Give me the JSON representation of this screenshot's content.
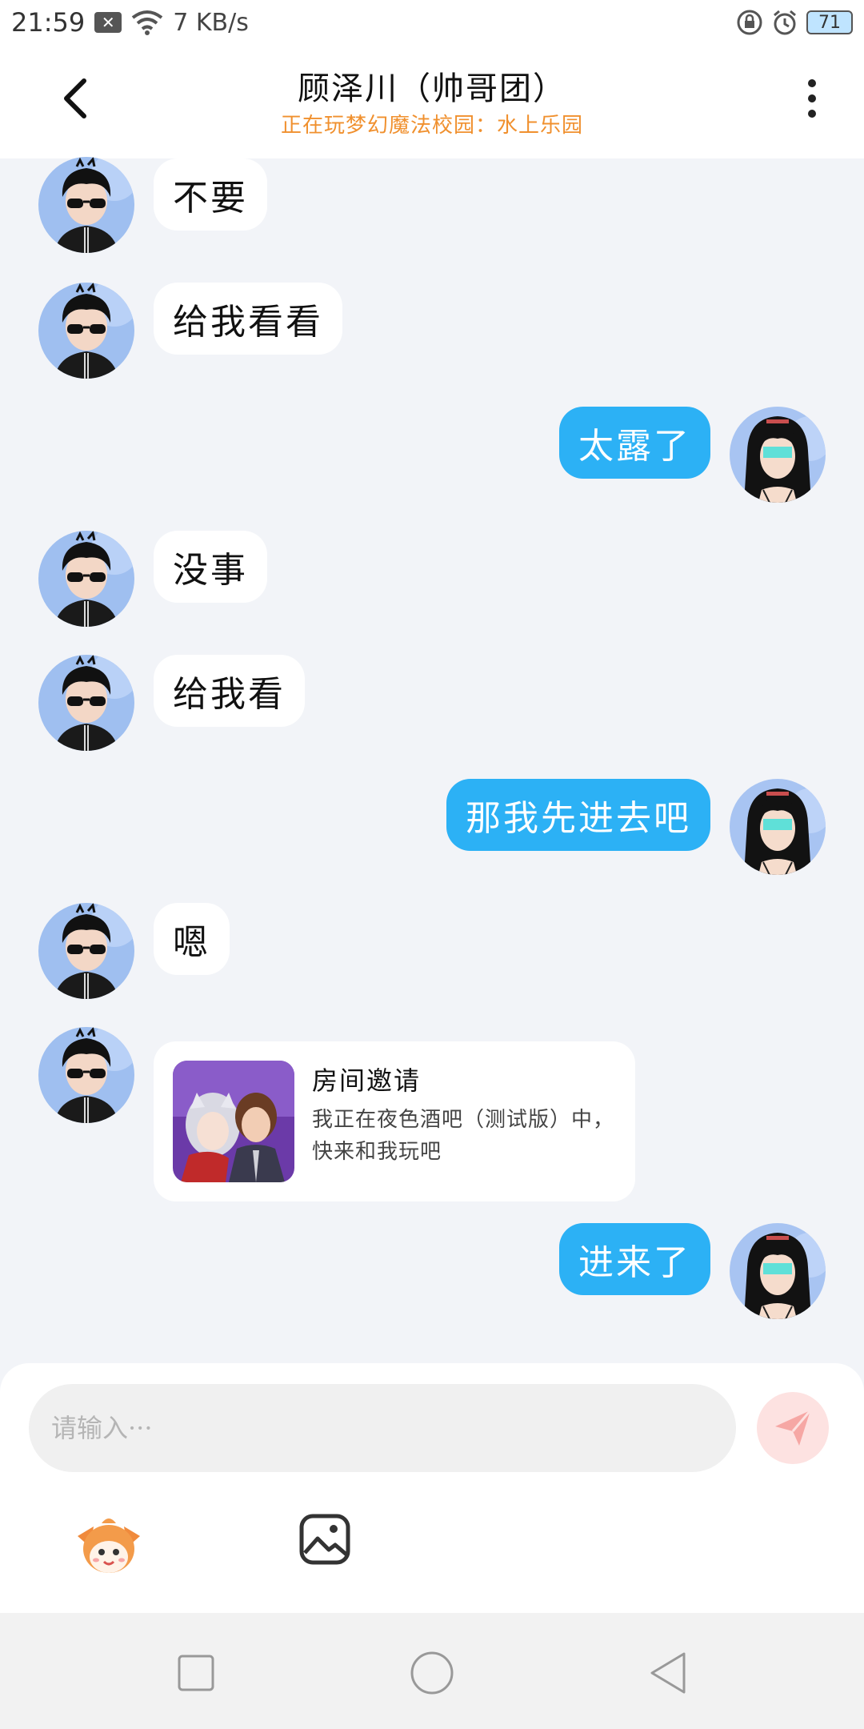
{
  "status_bar": {
    "time": "21:59",
    "network_speed": "7 KB/s",
    "battery": "71",
    "icons": [
      "notification-x-icon",
      "wifi-icon",
      "lock-rotation-icon",
      "alarm-icon",
      "battery-icon"
    ]
  },
  "header": {
    "title": "顾泽川（帅哥团）",
    "subtitle": "正在玩梦幻魔法校园：水上乐园",
    "subtitle_color": "#f0902e"
  },
  "messages": [
    {
      "side": "left",
      "text": "不要"
    },
    {
      "side": "left",
      "text": "给我看看"
    },
    {
      "side": "right",
      "text": "太露了"
    },
    {
      "side": "left",
      "text": "没事"
    },
    {
      "side": "left",
      "text": "给我看"
    },
    {
      "side": "right",
      "text": "那我先进去吧"
    },
    {
      "side": "left",
      "text": "嗯"
    },
    {
      "side": "left",
      "type": "invite",
      "title": "房间邀请",
      "desc": "我正在夜色酒吧（测试版）中，快来和我玩吧"
    },
    {
      "side": "right",
      "text": "进来了"
    }
  ],
  "input": {
    "placeholder": "请输入···"
  },
  "colors": {
    "accent_blue": "#2cb1f5",
    "send_button_bg": "#fde2e1",
    "send_button_icon": "#f59a9a"
  },
  "icons": {
    "back": "chevron-left-icon",
    "more": "more-vertical-icon",
    "send": "send-icon",
    "mascot": "mascot-emoji-icon",
    "image": "image-icon",
    "nav": [
      "nav-square-icon",
      "nav-circle-icon",
      "nav-back-triangle-icon"
    ]
  }
}
